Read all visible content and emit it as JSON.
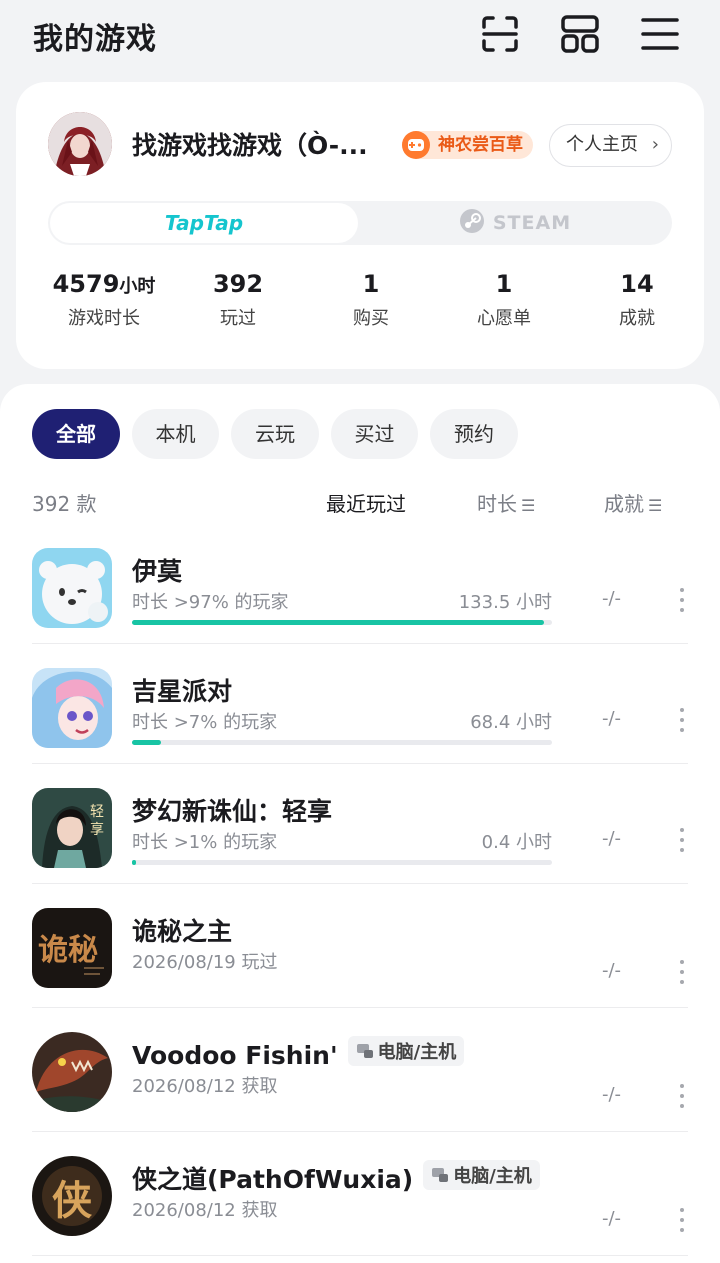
{
  "header": {
    "title": "我的游戏"
  },
  "profile": {
    "name": "找游戏找游戏（Ò-...",
    "badge": "神农尝百草",
    "home_button": "个人主页",
    "platforms": {
      "taptap": "TapTap",
      "steam": "STEAM",
      "active": "taptap"
    },
    "stats": [
      {
        "value": "4579",
        "unit": "小时",
        "label": "游戏时长"
      },
      {
        "value": "392",
        "unit": "",
        "label": "玩过"
      },
      {
        "value": "1",
        "unit": "",
        "label": "购买"
      },
      {
        "value": "1",
        "unit": "",
        "label": "心愿单"
      },
      {
        "value": "14",
        "unit": "",
        "label": "成就"
      }
    ]
  },
  "filters": {
    "chips": [
      "全部",
      "本机",
      "云玩",
      "买过",
      "预约"
    ],
    "active": "全部"
  },
  "list_header": {
    "count": "392 款",
    "sort_recent": "最近玩过",
    "sort_duration": "时长",
    "sort_achievement": "成就"
  },
  "games": [
    {
      "name": "伊莫",
      "sub": "时长 >97% 的玩家",
      "hours": "133.5 小时",
      "progress": 0.98,
      "achievement": "-/-",
      "icon": "emo-bear-icon"
    },
    {
      "name": "吉星派对",
      "sub": "时长 >7% 的玩家",
      "hours": "68.4 小时",
      "progress": 0.07,
      "achievement": "-/-",
      "icon": "star-party-icon"
    },
    {
      "name": "梦幻新诛仙：轻享",
      "sub": "时长 >1% 的玩家",
      "hours": "0.4 小时",
      "progress": 0.01,
      "achievement": "-/-",
      "icon": "zhuxian-icon"
    },
    {
      "name": "诡秘之主",
      "sub": "2026/08/19 玩过",
      "achievement": "-/-",
      "icon": "lord-of-mysteries-icon"
    },
    {
      "name": "Voodoo Fishin'",
      "tag": "电脑/主机",
      "sub": "2026/08/12 获取",
      "achievement": "-/-",
      "icon": "voodoo-fish-icon"
    },
    {
      "name": "侠之道(PathOfWuxia)",
      "tag": "电脑/主机",
      "sub": "2026/08/12 获取",
      "achievement": "-/-",
      "icon": "path-of-wuxia-icon"
    }
  ],
  "colors": {
    "accent": "#1f2073",
    "progress": "#18c4a4",
    "taptap": "#15c5ce",
    "badge": "#ea5a17"
  }
}
